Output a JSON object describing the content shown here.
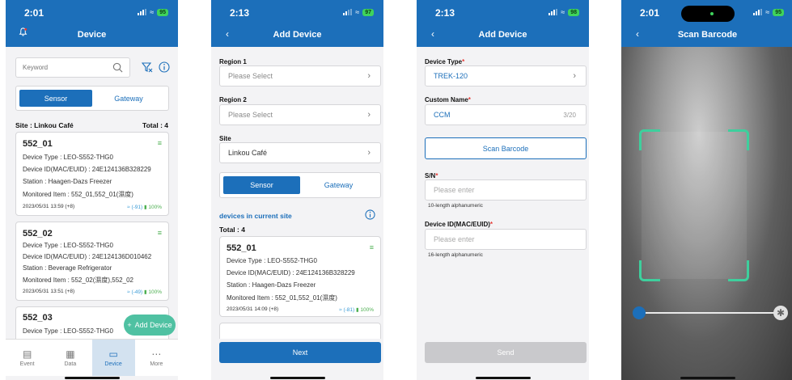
{
  "screens": [
    {
      "time": "2:01",
      "battery": "95",
      "title": "Device",
      "search_placeholder": "Keyword",
      "seg_sensor": "Sensor",
      "seg_gateway": "Gateway",
      "site_label": "Site : Linkou Café",
      "total_label": "Total : 4",
      "devices": [
        {
          "name": "552_01",
          "type": "Device Type : LEO-S552-THG0",
          "id": "Device ID(MAC/EUID) : 24E124136B328229",
          "station": "Station : Haagen-Dazs Freezer",
          "monitored": "Monitored Item : 552_01,552_01(濕度)",
          "timestamp": "2023/05/31 13:59 (+8)",
          "signal": "(-91)",
          "battery": "100%"
        },
        {
          "name": "552_02",
          "type": "Device Type : LEO-S552-THG0",
          "id": "Device ID(MAC/EUID) : 24E124136D010462",
          "station": "Station : Beverage Refrigerator",
          "monitored": "Monitored Item : 552_02(濕度),552_02",
          "timestamp": "2023/05/31 13:51 (+8)",
          "signal": "(-49)",
          "battery": "100%"
        },
        {
          "name": "552_03",
          "type": "Device Type : LEO-S552-THG0"
        }
      ],
      "fab_label": "Add Device",
      "tabs": [
        "Event",
        "Data",
        "Device",
        "More"
      ]
    },
    {
      "time": "2:13",
      "battery": "97",
      "title": "Add Device",
      "region1_label": "Region 1",
      "region1_value": "Please Select",
      "region2_label": "Region 2",
      "region2_value": "Please Select",
      "site_label": "Site",
      "site_value": "Linkou Café",
      "seg_sensor": "Sensor",
      "seg_gateway": "Gateway",
      "current_site_label": "devices in current site",
      "total_label": "Total : 4",
      "device": {
        "name": "552_01",
        "type": "Device Type : LEO-S552-THG0",
        "id": "Device ID(MAC/EUID) : 24E124136B328229",
        "station": "Station : Haagen-Dazs Freezer",
        "monitored": "Monitored Item : 552_01,552_01(濕度)",
        "timestamp": "2023/05/31 14:09 (+8)",
        "signal": "(-81)",
        "battery": "100%"
      },
      "next_label": "Next"
    },
    {
      "time": "2:13",
      "battery": "98",
      "title": "Add Device",
      "device_type_label": "Device Type",
      "device_type_value": "TREK-120",
      "custom_name_label": "Custom Name",
      "custom_name_value": "CCM",
      "custom_name_count": "3/20",
      "scan_label": "Scan Barcode",
      "sn_label": "S/N",
      "sn_placeholder": "Please enter",
      "sn_hint": "10-length alphanumeric",
      "devid_label": "Device ID(MAC/EUID)",
      "devid_placeholder": "Please enter",
      "devid_hint": "16-length alphanumeric",
      "send_label": "Send"
    },
    {
      "time": "2:01",
      "battery": "95",
      "title": "Scan Barcode",
      "zoom_level": 0.0
    }
  ],
  "colors": {
    "header": "#1c6fba",
    "accent": "#1c6fba",
    "fab": "#4fc1a2",
    "scan_frame": "#3ecf9d",
    "required": "#e53935"
  }
}
